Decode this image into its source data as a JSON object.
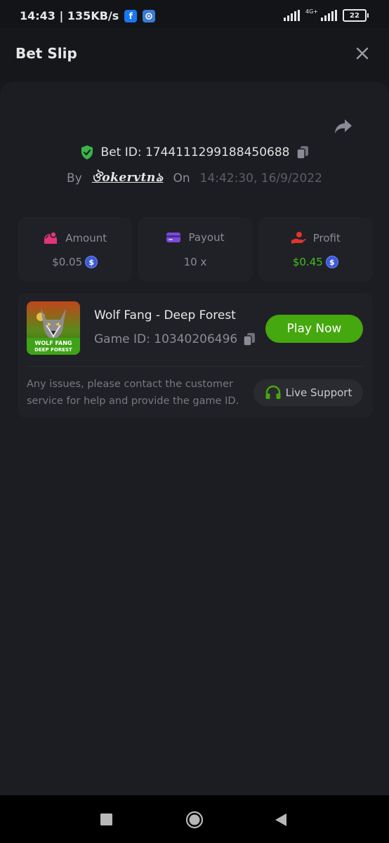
{
  "status_bar": {
    "time_speed": "14:43 | 135KB/s",
    "app_icons": [
      "facebook-icon",
      "messenger-icon"
    ],
    "network": "4G+",
    "battery": "22"
  },
  "header": {
    "title": "Bet Slip",
    "close_icon": "close-icon"
  },
  "bet": {
    "id_label": "Bet ID: 1744111299188450688",
    "by_label": "By",
    "username": "ঔokervtnঌ",
    "on_label": "On",
    "timestamp": "14:42:30, 16/9/2022"
  },
  "stats": [
    {
      "label": "Amount",
      "value": "$0.05",
      "icon": "amount-icon",
      "icon_color": "#e0357a"
    },
    {
      "label": "Payout",
      "value": "10 x",
      "icon": "payout-card-icon",
      "icon_color": "#7b4bd8"
    },
    {
      "label": "Profit",
      "value": "$0.45",
      "icon": "profit-hand-icon",
      "icon_color": "#e0342e",
      "value_color": "#3fbf1f"
    }
  ],
  "game": {
    "title": "Wolf Fang - Deep Forest",
    "id_label": "Game ID: 10340206496",
    "thumb_text_1": "WOLF FANG",
    "thumb_text_2": "DEEP FOREST",
    "play_label": "Play Now",
    "support_text": "Any issues, please contact the customer service for help and provide the game ID.",
    "live_support_label": "Live Support"
  },
  "colors": {
    "accent_green": "#45a80e",
    "panel": "#1c1d22",
    "card": "#202126"
  }
}
